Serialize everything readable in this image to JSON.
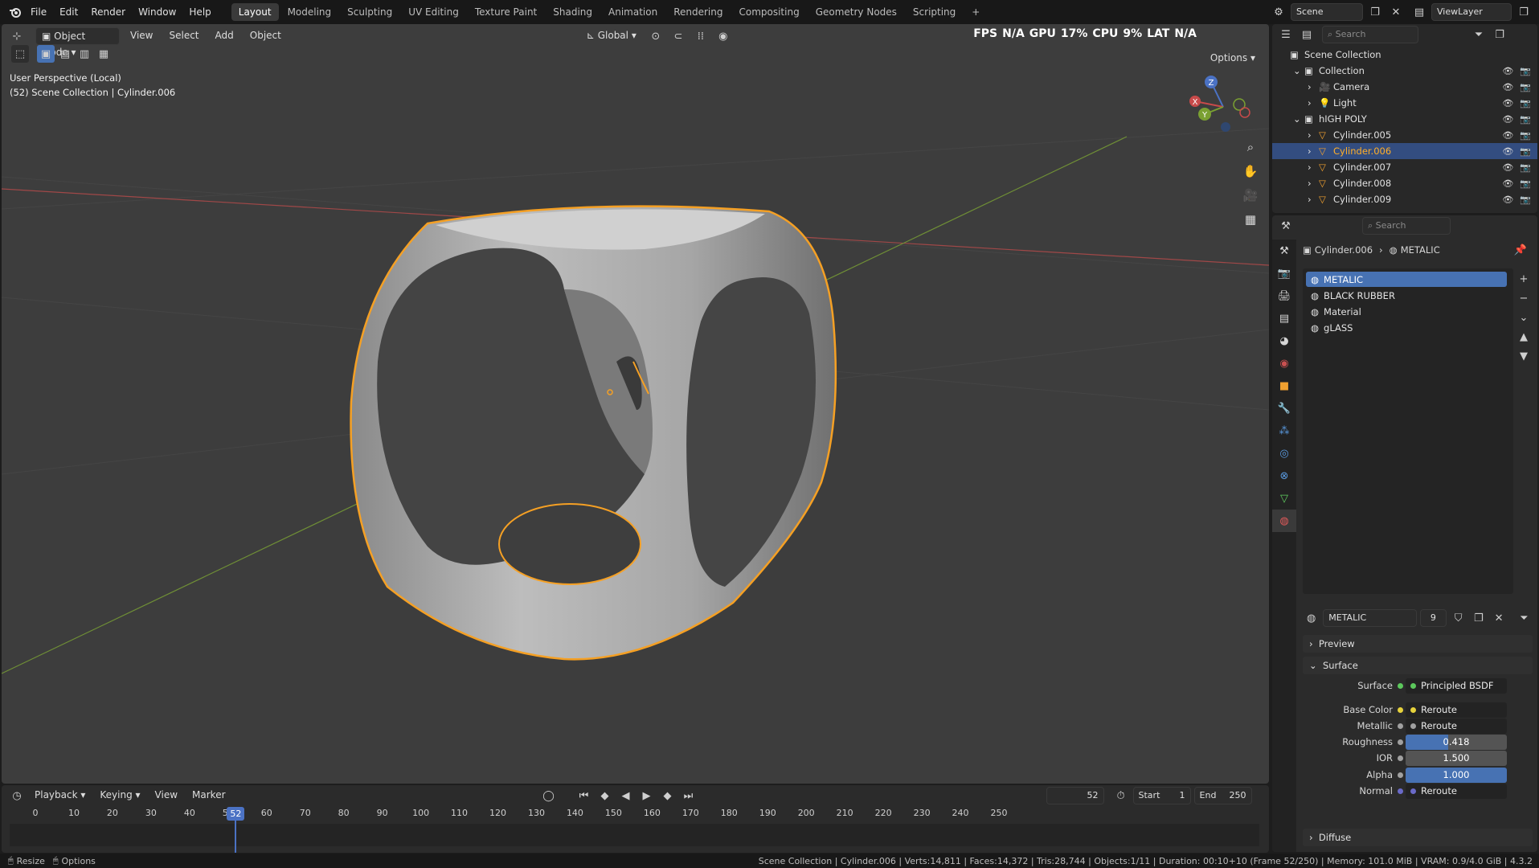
{
  "menubar": {
    "items": [
      "File",
      "Edit",
      "Render",
      "Window",
      "Help"
    ],
    "workspaces": [
      "Layout",
      "Modeling",
      "Sculpting",
      "UV Editing",
      "Texture Paint",
      "Shading",
      "Animation",
      "Rendering",
      "Compositing",
      "Geometry Nodes",
      "Scripting"
    ],
    "active_workspace": "Layout",
    "add_workspace": "+",
    "scene": "Scene",
    "view_layer": "ViewLayer"
  },
  "viewport": {
    "mode": "Object Mode",
    "menus": [
      "View",
      "Select",
      "Add",
      "Object"
    ],
    "orientation": "Global",
    "perspective_label": "User Perspective (Local)",
    "context_label": "(52) Scene Collection | Cylinder.006",
    "options": "Options",
    "overlay_stats": [
      "FPS",
      "N/A",
      "GPU",
      "17%",
      "CPU",
      "9%",
      "LAT",
      "N/A"
    ],
    "gizmo": {
      "x": "X",
      "y": "Y",
      "z": "Z"
    }
  },
  "timeline": {
    "menus": [
      "Playback",
      "Keying",
      "View",
      "Marker"
    ],
    "current_frame": "52",
    "start_label": "Start",
    "start": "1",
    "end_label": "End",
    "end": "250",
    "ticks": [
      "0",
      "10",
      "20",
      "30",
      "40",
      "50",
      "60",
      "70",
      "80",
      "90",
      "100",
      "110",
      "120",
      "130",
      "140",
      "150",
      "160",
      "170",
      "180",
      "190",
      "200",
      "210",
      "220",
      "230",
      "240",
      "250"
    ]
  },
  "outliner": {
    "search_placeholder": "Search",
    "items": [
      {
        "name": "Scene Collection",
        "depth": 0,
        "expanded": true
      },
      {
        "name": "Collection",
        "depth": 1,
        "expanded": true
      },
      {
        "name": "Camera",
        "depth": 2,
        "icon": "camera-icon"
      },
      {
        "name": "Light",
        "depth": 2,
        "icon": "light-icon"
      },
      {
        "name": "hIGH POLY",
        "depth": 1,
        "expanded": true
      },
      {
        "name": "Cylinder.005",
        "depth": 2,
        "icon": "mesh-icon"
      },
      {
        "name": "Cylinder.006",
        "depth": 2,
        "icon": "mesh-icon",
        "selected": true
      },
      {
        "name": "Cylinder.007",
        "depth": 2,
        "icon": "mesh-icon"
      },
      {
        "name": "Cylinder.008",
        "depth": 2,
        "icon": "mesh-icon"
      },
      {
        "name": "Cylinder.009",
        "depth": 2,
        "icon": "mesh-icon"
      }
    ]
  },
  "properties": {
    "search_placeholder": "Search",
    "breadcrumb_object": "Cylinder.006",
    "breadcrumb_material": "METALIC",
    "material_slots": [
      "METALIC",
      "BLACK RUBBER",
      "Material",
      "gLASS"
    ],
    "active_slot": "METALIC",
    "material_name": "METALIC",
    "user_count": "9",
    "panels": {
      "preview": "Preview",
      "surface": "Surface",
      "diffuse": "Diffuse"
    },
    "surface_rows": [
      {
        "label": "Surface",
        "value": "Principled BSDF",
        "type": "link",
        "dot": "#5cc85c"
      },
      {
        "label": "Base Color",
        "value": "Reroute",
        "type": "link",
        "dot": "#e6d23c"
      },
      {
        "label": "Metallic",
        "value": "Reroute",
        "type": "link",
        "dot": "#a0a0a0"
      },
      {
        "label": "Roughness",
        "value": "0.418",
        "type": "num",
        "fill": 0.418
      },
      {
        "label": "IOR",
        "value": "1.500",
        "type": "numdark"
      },
      {
        "label": "Alpha",
        "value": "1.000",
        "type": "num",
        "fill": 1.0
      },
      {
        "label": "Normal",
        "value": "Reroute",
        "type": "link",
        "dot": "#6a6ac8"
      }
    ]
  },
  "statusbar": {
    "left_items": [
      "Resize",
      "Options"
    ],
    "stats": "Scene Collection | Cylinder.006 | Verts:14,811 | Faces:14,372 | Tris:28,744 | Objects:1/11 | Duration: 00:10+10 (Frame 52/250) | Memory: 101.0 MiB | VRAM: 0.9/4.0 GiB | 4.3.2"
  },
  "colors": {
    "accent": "#4772b3",
    "selection_outline": "#f5a024",
    "viewport_bg": "#3d3d3d",
    "x_axis": "#c84a4a",
    "y_axis": "#7aa032"
  }
}
